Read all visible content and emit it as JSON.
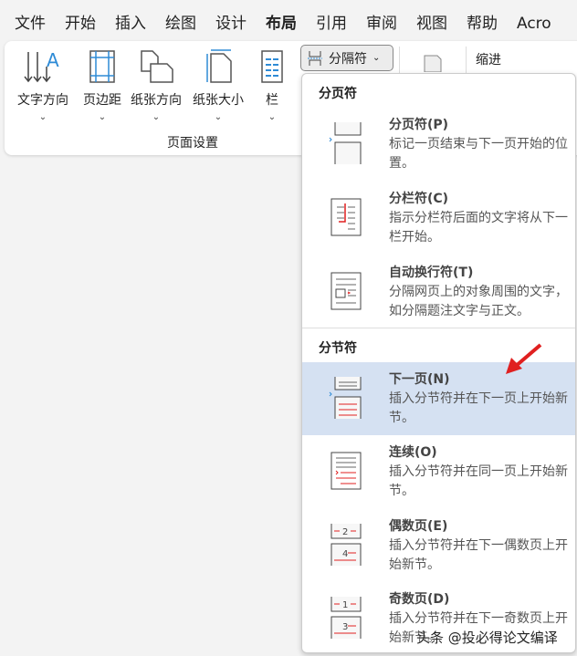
{
  "tabs": [
    "文件",
    "开始",
    "插入",
    "绘图",
    "设计",
    "布局",
    "引用",
    "审阅",
    "视图",
    "帮助",
    "Acro"
  ],
  "ribbon": {
    "buttons": [
      "文字方向",
      "页边距",
      "纸张方向",
      "纸张大小",
      "栏"
    ],
    "group_label": "页面设置",
    "breaks_button": "分隔符",
    "indent_label": "缩进"
  },
  "menu": {
    "page_breaks_header": "分页符",
    "section_breaks_header": "分节符",
    "items": [
      {
        "title": "分页符(P)",
        "desc": "标记一页结束与下一页开始的位置。"
      },
      {
        "title": "分栏符(C)",
        "desc": "指示分栏符后面的文字将从下一栏开始。"
      },
      {
        "title": "自动换行符(T)",
        "desc": "分隔网页上的对象周围的文字，如分隔题注文字与正文。"
      },
      {
        "title": "下一页(N)",
        "desc": "插入分节符并在下一页上开始新节。"
      },
      {
        "title": "连续(O)",
        "desc": "插入分节符并在同一页上开始新节。"
      },
      {
        "title": "偶数页(E)",
        "desc": "插入分节符并在下一偶数页上开始新节。"
      },
      {
        "title": "奇数页(D)",
        "desc": "插入分节符并在下一奇数页上开始新节。"
      }
    ]
  },
  "watermark": "头条 @投必得论文编译",
  "colors": {
    "accent": "#1a4fa0",
    "highlight": "#d5e1f2",
    "arrow": "#e02020"
  }
}
